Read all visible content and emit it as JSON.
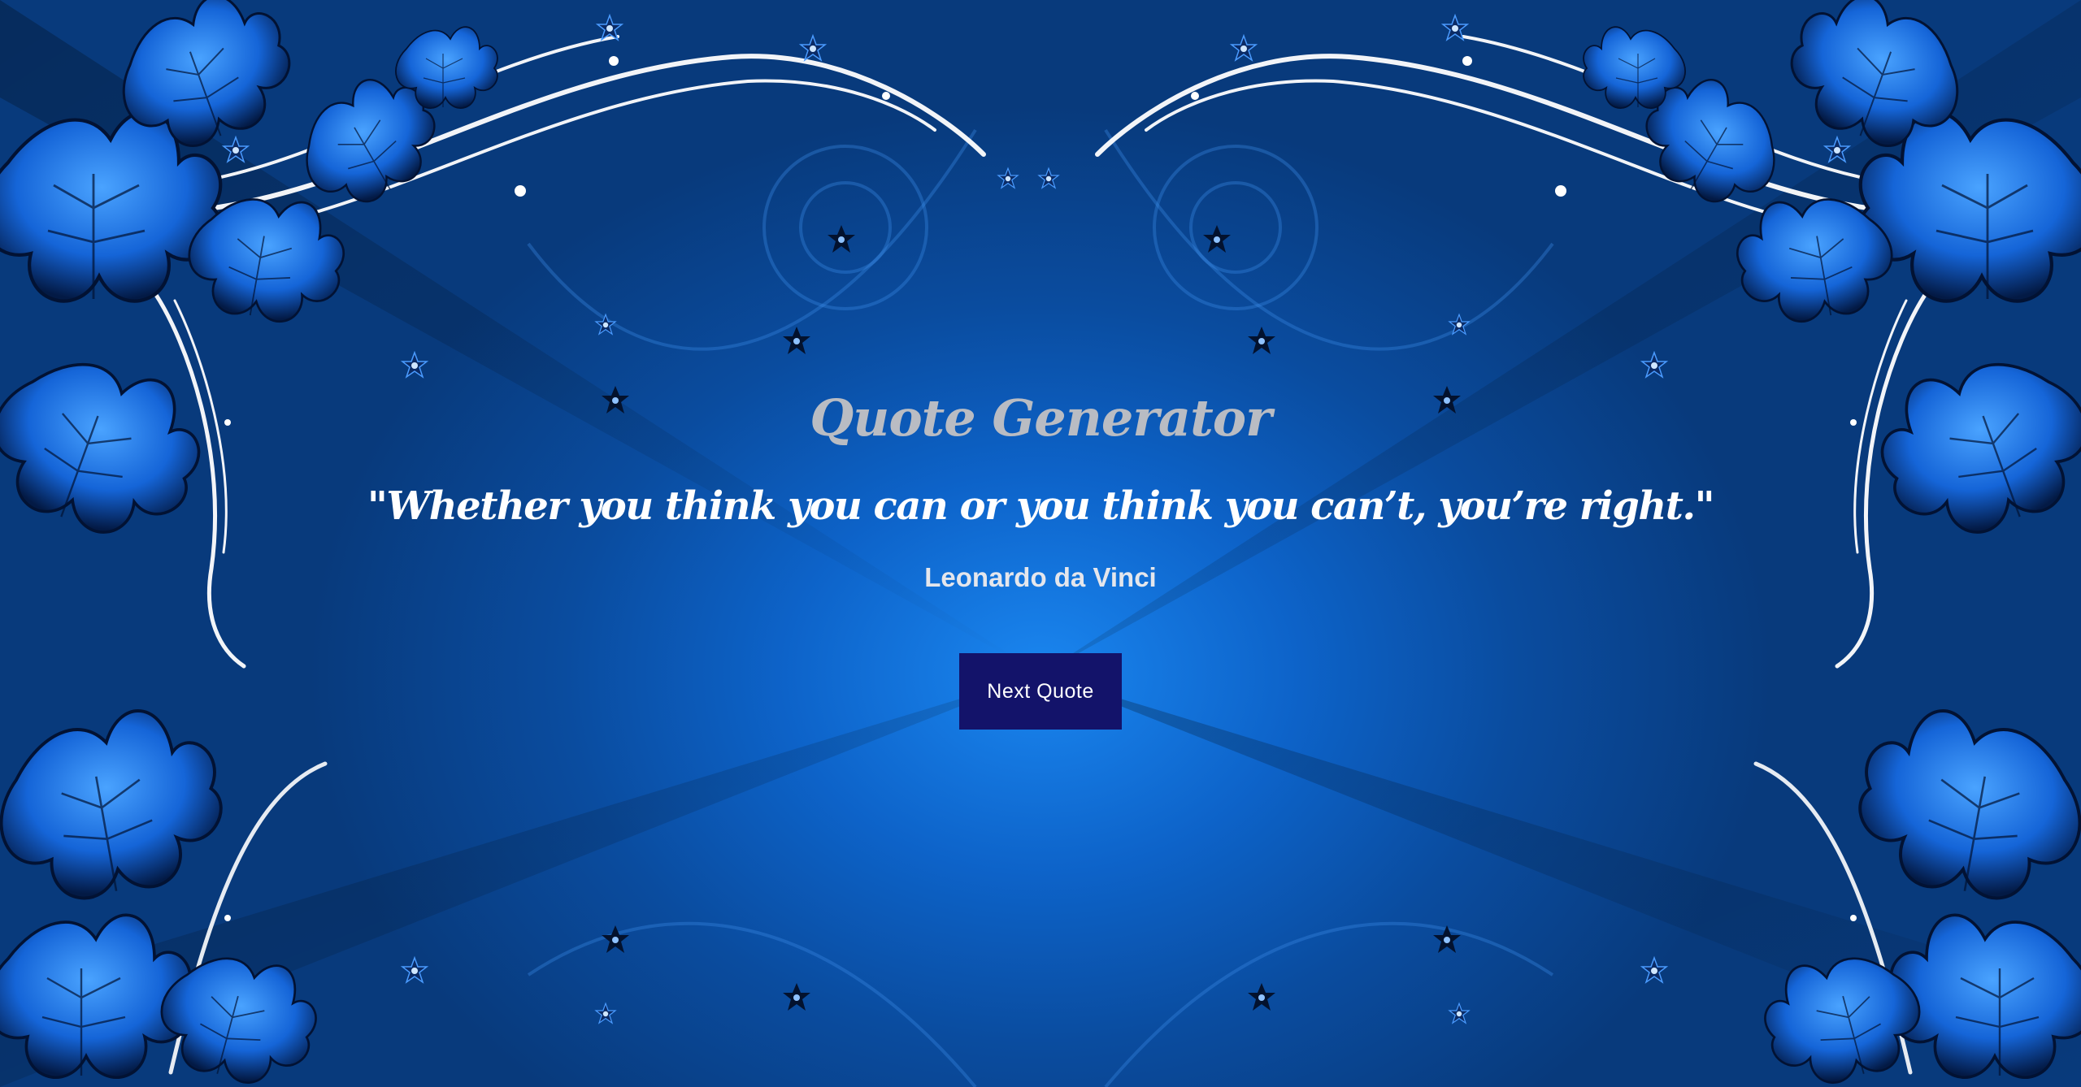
{
  "app": {
    "title": "Quote Generator"
  },
  "quote": {
    "text": "\"Whether you think you can or you think you can’t, you’re right.\"",
    "author": "Leonardo da Vinci"
  },
  "actions": {
    "next_label": "Next Quote"
  },
  "colors": {
    "background_center": "#1a86f0",
    "background_edge": "#083a7c",
    "title": "#b9bcc3",
    "quote": "#ffffff",
    "button": "#13136a"
  }
}
